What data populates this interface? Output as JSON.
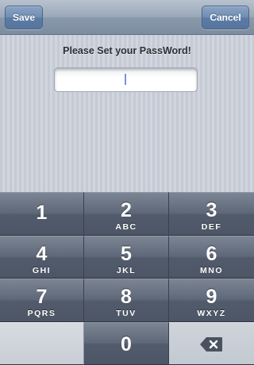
{
  "toolbar": {
    "save_label": "Save",
    "cancel_label": "Cancel"
  },
  "prompt": {
    "label": "Please Set your PassWord!",
    "field_value": ""
  },
  "keypad": {
    "keys": [
      {
        "digit": "1",
        "letters": ""
      },
      {
        "digit": "2",
        "letters": "ABC"
      },
      {
        "digit": "3",
        "letters": "DEF"
      },
      {
        "digit": "4",
        "letters": "GHI"
      },
      {
        "digit": "5",
        "letters": "JKL"
      },
      {
        "digit": "6",
        "letters": "MNO"
      },
      {
        "digit": "7",
        "letters": "PQRS"
      },
      {
        "digit": "8",
        "letters": "TUV"
      },
      {
        "digit": "9",
        "letters": "WXYZ"
      },
      {
        "digit": "0",
        "letters": ""
      }
    ],
    "delete_icon": "backspace-icon"
  },
  "colors": {
    "nav_button": "#5c7ca6",
    "key_dark": "#525b6b",
    "key_light": "#c9ced6",
    "caret": "#7b8fe4"
  }
}
